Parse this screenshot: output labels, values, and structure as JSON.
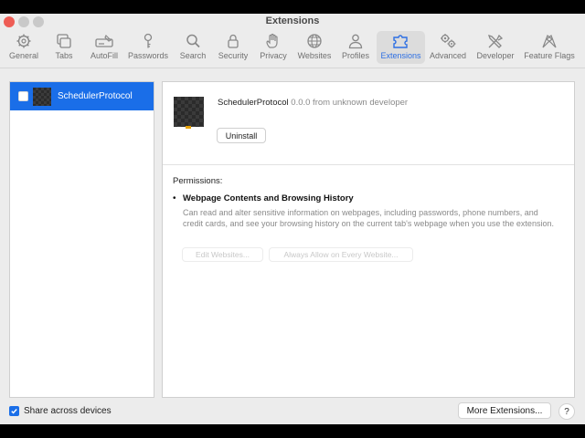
{
  "window": {
    "title": "Extensions"
  },
  "toolbar": {
    "items": [
      {
        "label": "General",
        "icon": "gear-icon"
      },
      {
        "label": "Tabs",
        "icon": "tabs-icon"
      },
      {
        "label": "AutoFill",
        "icon": "autofill-icon"
      },
      {
        "label": "Passwords",
        "icon": "key-icon"
      },
      {
        "label": "Search",
        "icon": "search-icon"
      },
      {
        "label": "Security",
        "icon": "lock-icon"
      },
      {
        "label": "Privacy",
        "icon": "hand-icon"
      },
      {
        "label": "Websites",
        "icon": "globe-icon"
      },
      {
        "label": "Profiles",
        "icon": "person-icon"
      },
      {
        "label": "Extensions",
        "icon": "puzzle-icon",
        "active": true
      },
      {
        "label": "Advanced",
        "icon": "gears-icon"
      },
      {
        "label": "Developer",
        "icon": "tools-icon"
      },
      {
        "label": "Feature Flags",
        "icon": "flags-icon"
      }
    ],
    "active_color": "#2d6fe3"
  },
  "sidebar": {
    "extensions": [
      {
        "name": "SchedulerProtocol",
        "enabled": false,
        "selected": true
      }
    ]
  },
  "detail": {
    "name": "SchedulerProtocol",
    "subtitle": "0.0.0 from unknown developer",
    "uninstall_label": "Uninstall",
    "permissions_label": "Permissions:",
    "permission_heading": "Webpage Contents and Browsing History",
    "permission_description": "Can read and alter sensitive information on webpages, including passwords, phone numbers, and credit cards, and see your browsing history on the current tab's webpage when you use the extension.",
    "edit_websites_label": "Edit Websites...",
    "always_allow_label": "Always Allow on Every Website..."
  },
  "footer": {
    "share_label": "Share across devices",
    "share_checked": true,
    "more_extensions_label": "More Extensions...",
    "help_label": "?"
  }
}
